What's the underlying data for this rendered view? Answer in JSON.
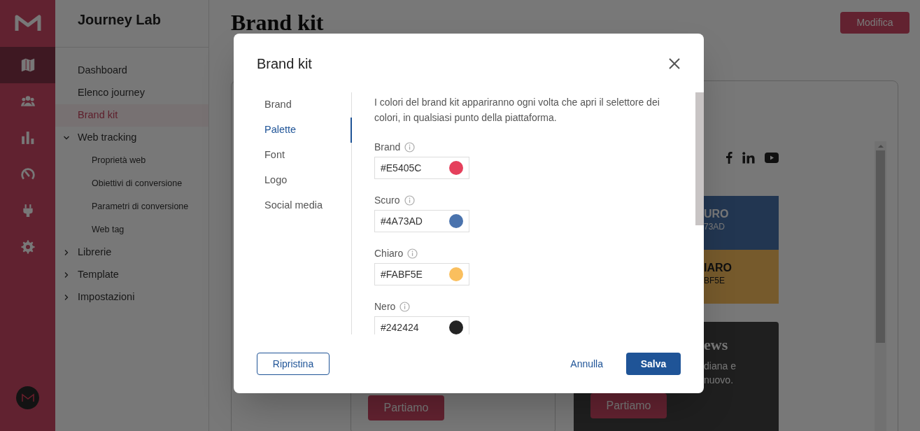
{
  "rail": {
    "items": [
      {
        "kind": "map",
        "selected": true
      },
      {
        "kind": "users",
        "selected": false
      },
      {
        "kind": "chart",
        "selected": false
      },
      {
        "kind": "gauge",
        "selected": false
      },
      {
        "kind": "plug",
        "selected": false
      },
      {
        "kind": "gear",
        "selected": false
      }
    ]
  },
  "app_title": "Journey Lab",
  "nav": [
    {
      "label": "Dashboard",
      "selected": false
    },
    {
      "label": "Elenco journey",
      "selected": false
    },
    {
      "label": "Brand kit",
      "selected": true
    },
    {
      "label": "Web tracking",
      "selected": false,
      "expanded": true,
      "children": [
        {
          "label": "Proprietà web"
        },
        {
          "label": "Obiettivi di conversione"
        },
        {
          "label": "Parametri di conversione"
        },
        {
          "label": "Web tag"
        }
      ]
    },
    {
      "label": "Librerie",
      "selected": false,
      "expanded": false
    },
    {
      "label": "Template",
      "selected": false,
      "expanded": false
    },
    {
      "label": "Impostazioni",
      "selected": false,
      "expanded": false
    }
  ],
  "page": {
    "heading": "Brand kit",
    "edit_button": "Modifica"
  },
  "preview": {
    "left_card": {
      "button": "Partiamo"
    },
    "right_card": {
      "swatches": [
        {
          "title": "URO",
          "code": "73AD",
          "kind": "dark"
        },
        {
          "title": "IARO",
          "code": "BF5E",
          "kind": "light"
        }
      ],
      "news": {
        "title": "ews",
        "lines": [
          "diana e",
          "nuovo."
        ],
        "button": "Partiamo"
      }
    }
  },
  "modal": {
    "title": "Brand kit",
    "tabs": [
      {
        "label": "Brand",
        "selected": false
      },
      {
        "label": "Palette",
        "selected": true
      },
      {
        "label": "Font",
        "selected": false
      },
      {
        "label": "Logo",
        "selected": false
      },
      {
        "label": "Social media",
        "selected": false
      }
    ],
    "description": "I colori del brand kit appariranno ogni volta che apri il selettore dei colori, in qualsiasi punto della piattaforma.",
    "colors": [
      {
        "label": "Brand",
        "value": "#E5405C",
        "color": "#e5405c"
      },
      {
        "label": "Scuro",
        "value": "#4A73AD",
        "color": "#4a73ad"
      },
      {
        "label": "Chiaro",
        "value": "#FABF5E",
        "color": "#fabf5e"
      },
      {
        "label": "Nero",
        "value": "#242424",
        "color": "#242424"
      }
    ],
    "buttons": {
      "reset": "Ripristina",
      "cancel": "Annulla",
      "save": "Salva"
    }
  }
}
